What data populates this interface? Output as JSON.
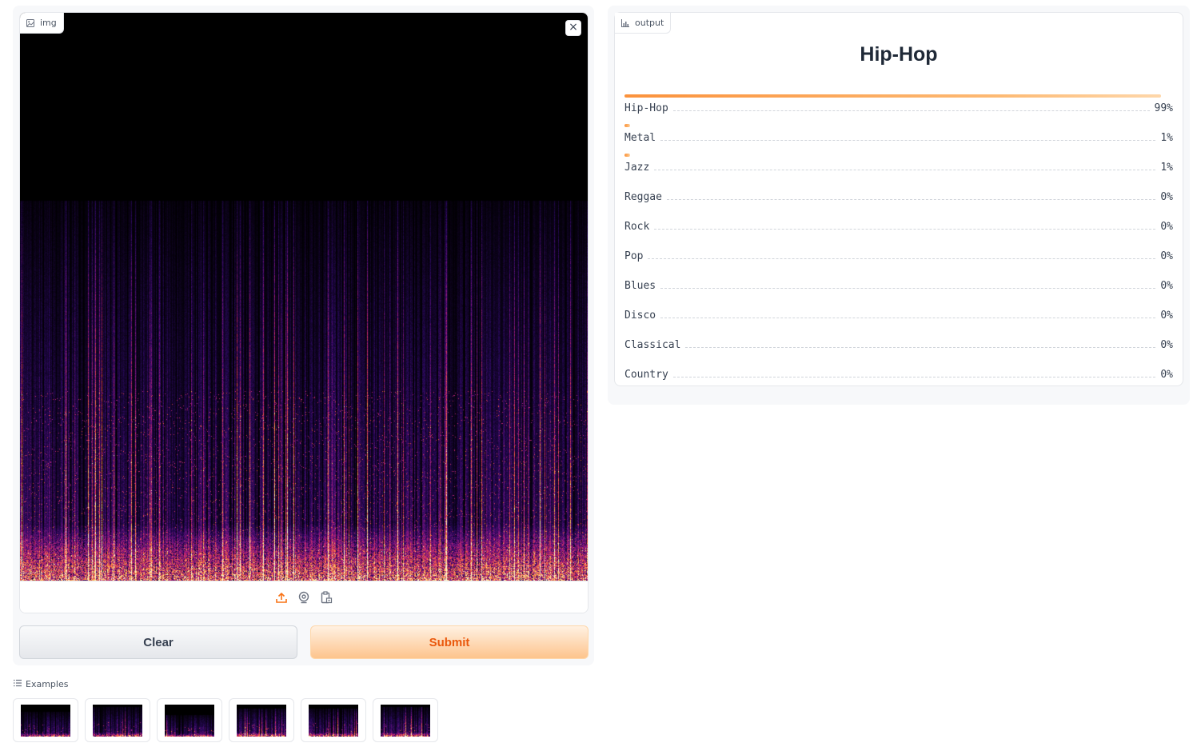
{
  "input": {
    "label": "img",
    "label_icon": "image-icon",
    "clear_icon_text": "×",
    "source_icons": [
      "upload-icon",
      "webcam-icon",
      "clipboard-icon"
    ]
  },
  "buttons": {
    "clear": "Clear",
    "submit": "Submit"
  },
  "examples": {
    "header": "Examples",
    "count": 6,
    "header_icon": "list-icon"
  },
  "output": {
    "label": "output",
    "label_icon": "bar-chart-icon",
    "title": "Hip-Hop",
    "confidences": [
      {
        "label": "Hip-Hop",
        "value": 0.99,
        "display": "99%"
      },
      {
        "label": "Metal",
        "value": 0.01,
        "display": "1%"
      },
      {
        "label": "Jazz",
        "value": 0.01,
        "display": "1%"
      },
      {
        "label": "Reggae",
        "value": 0.0,
        "display": "0%"
      },
      {
        "label": "Rock",
        "value": 0.0,
        "display": "0%"
      },
      {
        "label": "Pop",
        "value": 0.0,
        "display": "0%"
      },
      {
        "label": "Blues",
        "value": 0.0,
        "display": "0%"
      },
      {
        "label": "Disco",
        "value": 0.0,
        "display": "0%"
      },
      {
        "label": "Classical",
        "value": 0.0,
        "display": "0%"
      },
      {
        "label": "Country",
        "value": 0.0,
        "display": "0%"
      }
    ]
  },
  "colors": {
    "accent": "#f97316",
    "submit_text": "#ea580c",
    "panel_bg": "#f7f8fa"
  }
}
